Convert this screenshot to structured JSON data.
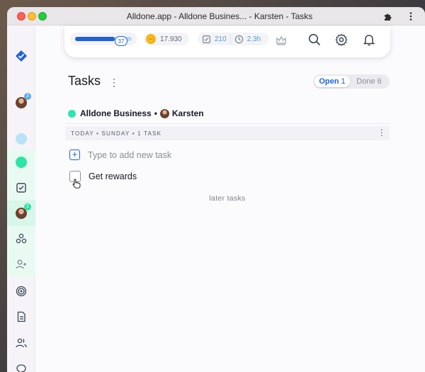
{
  "window": {
    "title": "Alldone.app - Alldone Busines... - Karsten - Tasks"
  },
  "sidebar": {
    "items": [
      {
        "name": "logo"
      },
      {
        "name": "user-avatar",
        "badge": "2"
      },
      {
        "name": "project-blue"
      },
      {
        "name": "project-green"
      },
      {
        "name": "tasks"
      },
      {
        "name": "user-avatar-active",
        "badge": "1"
      },
      {
        "name": "integrations"
      },
      {
        "name": "add-user"
      },
      {
        "name": "goals"
      },
      {
        "name": "notes"
      },
      {
        "name": "contacts"
      },
      {
        "name": "chats"
      }
    ]
  },
  "topbar": {
    "level": "37",
    "progress_percent": 70,
    "gold": "17.930",
    "done_count": "210",
    "time": "2.3h"
  },
  "page": {
    "title": "Tasks",
    "tabs": {
      "open_label": "Open",
      "open_count": "1",
      "done_label": "Done",
      "done_count": "6"
    },
    "project_name": "Alldone Business",
    "bullet": "•",
    "user_name": "Karsten",
    "day_header": "TODAY • SUNDAY • 1 TASK",
    "add_placeholder": "Type to add new task",
    "task_label": "Get rewards",
    "later_label": "later tasks"
  },
  "colors": {
    "accent": "#1e63d6",
    "project": "#2ce5b0",
    "gold": "#f5b60f",
    "sidebar_active": "#d8f6ea"
  }
}
